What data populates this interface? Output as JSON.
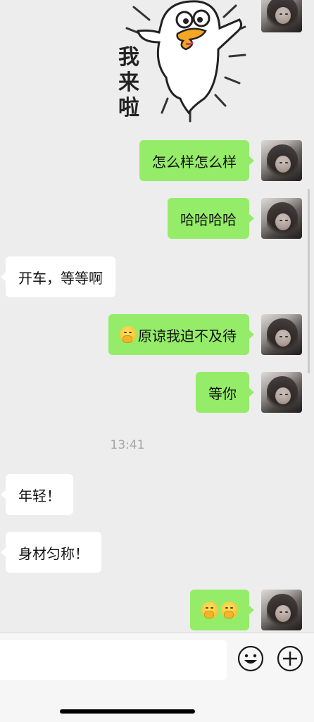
{
  "sticker": {
    "text": "我来啦",
    "icon": "duck-sticker"
  },
  "messages": [
    {
      "dir": "out",
      "text": "怎么样怎么样"
    },
    {
      "dir": "out",
      "text": "哈哈哈哈"
    },
    {
      "dir": "in",
      "text": "开车，等等啊"
    },
    {
      "dir": "out",
      "text": "原谅我迫不及待",
      "emoji_prefix": "covering-mouth-emoji"
    },
    {
      "dir": "out",
      "text": "等你"
    },
    {
      "dir": "in",
      "text": "年轻！"
    },
    {
      "dir": "in",
      "text": "身材匀称！"
    },
    {
      "dir": "out",
      "text": "",
      "emojis": [
        "covering-mouth-emoji",
        "covering-mouth-emoji"
      ]
    }
  ],
  "timestamp": "13:41",
  "inputbar": {
    "input_value": "",
    "emoji_button_icon": "smiley-icon",
    "plus_button_icon": "plus-circle-icon"
  },
  "colors": {
    "outgoing_bubble": "#95ec69",
    "incoming_bubble": "#ffffff",
    "background": "#ededed"
  }
}
